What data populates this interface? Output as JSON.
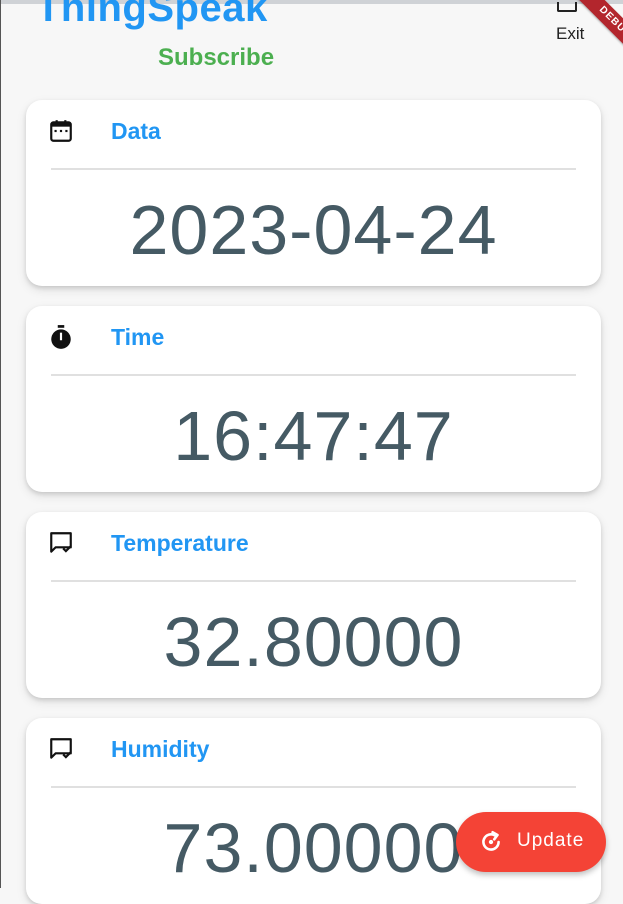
{
  "app": {
    "title": "ThingSpeak",
    "subscribe_label": "Subscribe",
    "exit_label": "Exit",
    "debug_banner": "DEBUG"
  },
  "cards": [
    {
      "label": "Data",
      "value": "2023-04-24",
      "icon": "calendar-icon"
    },
    {
      "label": "Time",
      "value": "16:47:47",
      "icon": "timer-icon"
    },
    {
      "label": "Temperature",
      "value": "32.80000",
      "icon": "message-check-icon"
    },
    {
      "label": "Humidity",
      "value": "73.00000",
      "icon": "message-check-icon"
    }
  ],
  "fab": {
    "label": "Update",
    "icon": "refresh-icon"
  },
  "colors": {
    "accent": "#2196f3",
    "subscribe": "#4caf50",
    "value_text": "#455a64",
    "fab": "#f44336",
    "debug": "#b3262d"
  }
}
